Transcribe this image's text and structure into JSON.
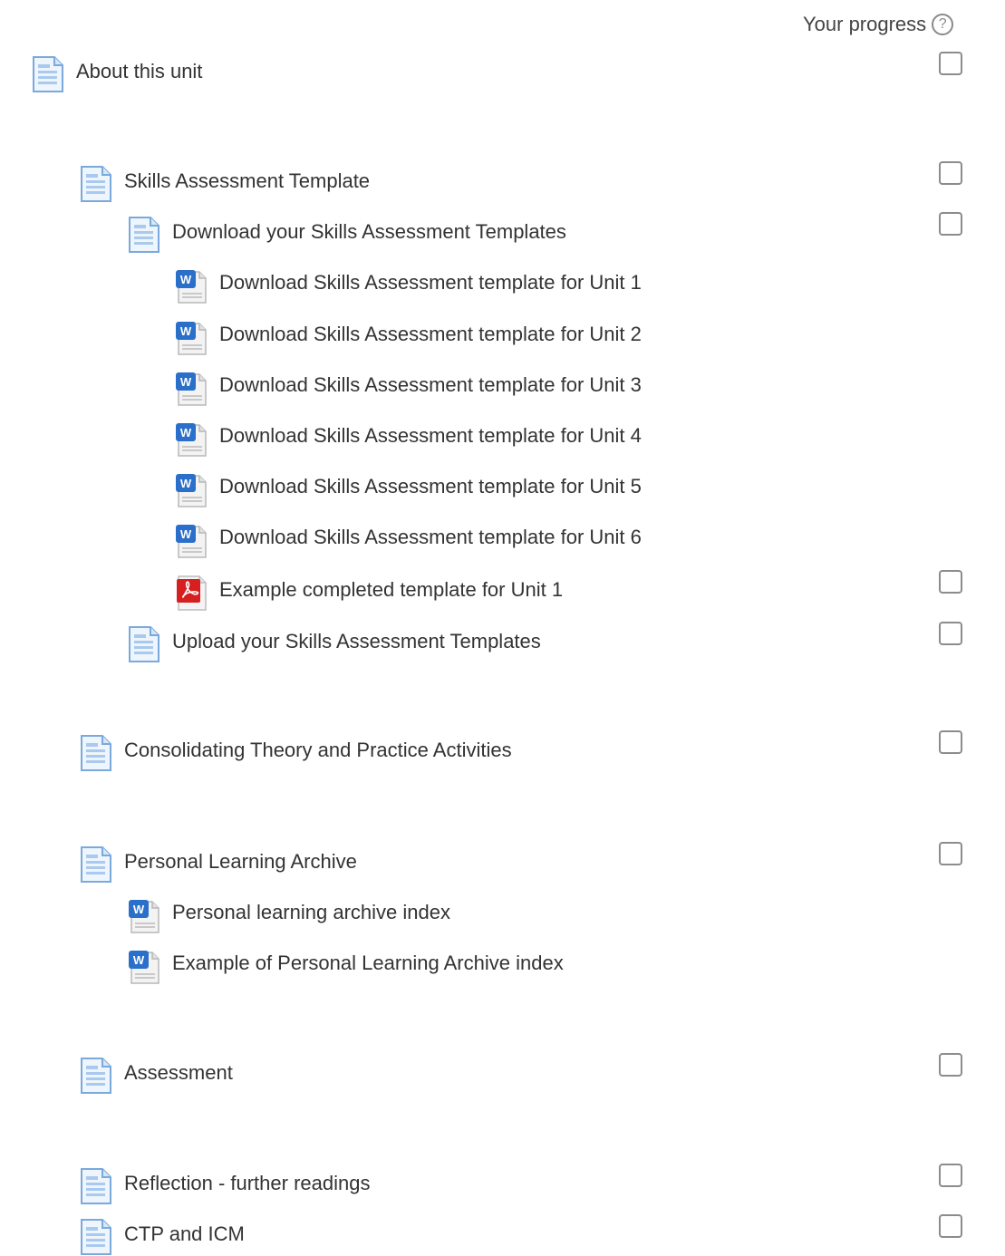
{
  "header": {
    "progress_label": "Your progress",
    "help_glyph": "?"
  },
  "colors": {
    "page_icon_blue": "#8bb7e3",
    "word_icon_blue": "#2a6fc9",
    "pdf_red": "#d61f1f",
    "checkbox_border": "#8c8c8c"
  },
  "items": [
    {
      "label": "About this unit",
      "level": 0,
      "icon": "page-icon",
      "checkbox": true
    },
    {
      "label": "Skills Assessment Template",
      "level": 1,
      "icon": "page-icon",
      "checkbox": true
    },
    {
      "label": "Download your Skills Assessment Templates",
      "level": 2,
      "icon": "page-icon",
      "checkbox": true
    },
    {
      "label": "Download Skills Assessment template for Unit 1",
      "level": 3,
      "icon": "word-document-icon",
      "checkbox": false
    },
    {
      "label": "Download Skills Assessment template for Unit 2",
      "level": 3,
      "icon": "word-document-icon",
      "checkbox": false
    },
    {
      "label": "Download Skills Assessment template for Unit 3",
      "level": 3,
      "icon": "word-document-icon",
      "checkbox": false
    },
    {
      "label": "Download Skills Assessment template for Unit 4",
      "level": 3,
      "icon": "word-document-icon",
      "checkbox": false
    },
    {
      "label": "Download Skills Assessment template for Unit 5",
      "level": 3,
      "icon": "word-document-icon",
      "checkbox": false
    },
    {
      "label": "Download Skills Assessment template for Unit 6",
      "level": 3,
      "icon": "word-document-icon",
      "checkbox": false
    },
    {
      "label": "Example completed template for Unit 1",
      "level": 3,
      "icon": "pdf-icon",
      "checkbox": true
    },
    {
      "label": "Upload your Skills Assessment Templates",
      "level": 2,
      "icon": "page-icon",
      "checkbox": true
    },
    {
      "label": "Consolidating Theory and Practice Activities",
      "level": 1,
      "icon": "page-icon",
      "checkbox": true
    },
    {
      "label": "Personal Learning Archive",
      "level": 1,
      "icon": "page-icon",
      "checkbox": true
    },
    {
      "label": "Personal learning archive index",
      "level": 2,
      "icon": "word-document-icon",
      "checkbox": false
    },
    {
      "label": "Example of Personal Learning Archive index",
      "level": 2,
      "icon": "word-document-icon",
      "checkbox": false
    },
    {
      "label": "Assessment",
      "level": 1,
      "icon": "page-icon",
      "checkbox": true
    },
    {
      "label": "Reflection - further readings",
      "level": 1,
      "icon": "page-icon",
      "checkbox": true
    },
    {
      "label": "CTP and ICM",
      "level": 1,
      "icon": "page-icon",
      "checkbox": true
    }
  ]
}
